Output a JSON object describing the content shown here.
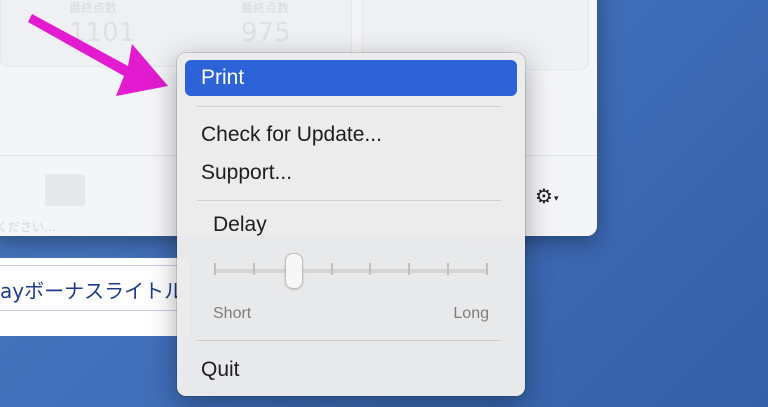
{
  "background_window": {
    "stat_1_label": "最終点数",
    "stat_1_value": "1101",
    "stat_2_label": "最終点数",
    "stat_2_value": "975",
    "bottom_text": "ください...",
    "text_field_value": "ayボーナスライトル"
  },
  "menu": {
    "items": [
      {
        "label": "Print",
        "selected": true
      },
      {
        "label": "Check for Update..."
      },
      {
        "label": "Support..."
      },
      {
        "label": "Quit"
      }
    ],
    "delay": {
      "label": "Delay",
      "min_label": "Short",
      "max_label": "Long",
      "tick_count": 8,
      "value_fraction": 0.29
    }
  },
  "icons": {
    "gear": "gear-icon",
    "arrow": "pointer-arrow-icon"
  },
  "colors": {
    "accent": "#2d63d7",
    "arrow": "#e21bd0"
  }
}
